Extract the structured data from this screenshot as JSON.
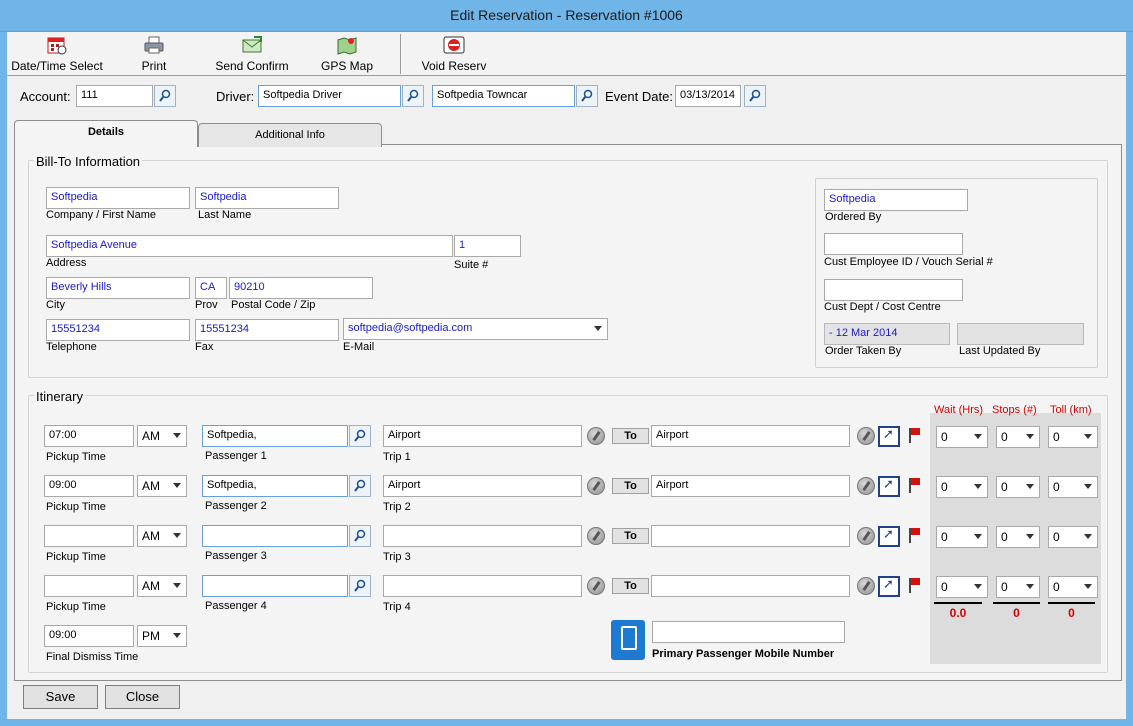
{
  "window": {
    "title": "Edit Reservation - Reservation #1006"
  },
  "toolbar": {
    "datetime_label": "Date/Time Select",
    "print_label": "Print",
    "send_confirm_label": "Send Confirm",
    "gps_map_label": "GPS Map",
    "void_label": "Void Reserv"
  },
  "header": {
    "account_label": "Account:",
    "account_value": "111",
    "driver_label": "Driver:",
    "driver_value": "Softpedia Driver",
    "vehicle_value": "Softpedia Towncar",
    "event_date_label": "Event Date:",
    "event_date_value": "03/13/2014"
  },
  "tabs": {
    "details": "Details",
    "additional": "Additional Info"
  },
  "billto": {
    "title": "Bill-To Information",
    "company_value": "Softpedia",
    "company_label": "Company / First Name",
    "last_name_value": "Softpedia",
    "last_name_label": "Last Name",
    "address_value": "Softpedia Avenue",
    "address_label": "Address",
    "suite_value": "1",
    "suite_label": "Suite #",
    "city_value": "Beverly Hills",
    "city_label": "City",
    "prov_value": "CA",
    "prov_label": "Prov",
    "postal_value": "90210",
    "postal_label": "Postal Code / Zip",
    "telephone_value": "15551234",
    "telephone_label": "Telephone",
    "fax_value": "15551234",
    "fax_label": "Fax",
    "email_value": "softpedia@softpedia.com",
    "email_label": "E-Mail",
    "ordered_by_value": "Softpedia",
    "ordered_by_label": "Ordered By",
    "cust_emp_label": "Cust Employee ID / Vouch Serial #",
    "cust_dept_label": "Cust Dept / Cost Centre",
    "order_taken_value": "- 12 Mar 2014",
    "order_taken_label": "Order Taken By",
    "last_updated_label": "Last Updated By"
  },
  "itinerary": {
    "title": "Itinerary",
    "wait_label": "Wait (Hrs)",
    "stops_label": "Stops (#)",
    "toll_label": "Toll (km)",
    "rows": [
      {
        "time": "07:00",
        "ampm": "AM",
        "time_label": "Pickup Time",
        "passenger": "Softpedia,",
        "passenger_label": "Passenger 1",
        "from": "Airport",
        "trip_label": "Trip 1",
        "to_btn": "To",
        "to": "Airport",
        "wait": "0",
        "stops": "0",
        "toll": "0"
      },
      {
        "time": "09:00",
        "ampm": "AM",
        "time_label": "Pickup Time",
        "passenger": "Softpedia,",
        "passenger_label": "Passenger 2",
        "from": "Airport",
        "trip_label": "Trip 2",
        "to_btn": "To",
        "to": "Airport",
        "wait": "0",
        "stops": "0",
        "toll": "0"
      },
      {
        "time": "",
        "ampm": "AM",
        "time_label": "Pickup Time",
        "passenger": "",
        "passenger_label": "Passenger 3",
        "from": "",
        "trip_label": "Trip 3",
        "to_btn": "To",
        "to": "",
        "wait": "0",
        "stops": "0",
        "toll": "0"
      },
      {
        "time": "",
        "ampm": "AM",
        "time_label": "Pickup Time",
        "passenger": "",
        "passenger_label": "Passenger 4",
        "from": "",
        "trip_label": "Trip 4",
        "to_btn": "To",
        "to": "",
        "wait": "0",
        "stops": "0",
        "toll": "0"
      }
    ],
    "dismiss_time": "09:00",
    "dismiss_ampm": "PM",
    "dismiss_label": "Final Dismiss Time",
    "mobile_label": "Primary Passenger Mobile Number",
    "total_wait": "0.0",
    "total_stops": "0",
    "total_toll": "0"
  },
  "footer": {
    "save_label": "Save",
    "close_label": "Close"
  },
  "colors": {
    "titlebar": "#6fb5e8",
    "value_text": "#1a1acd",
    "accent_red": "#d40000"
  }
}
